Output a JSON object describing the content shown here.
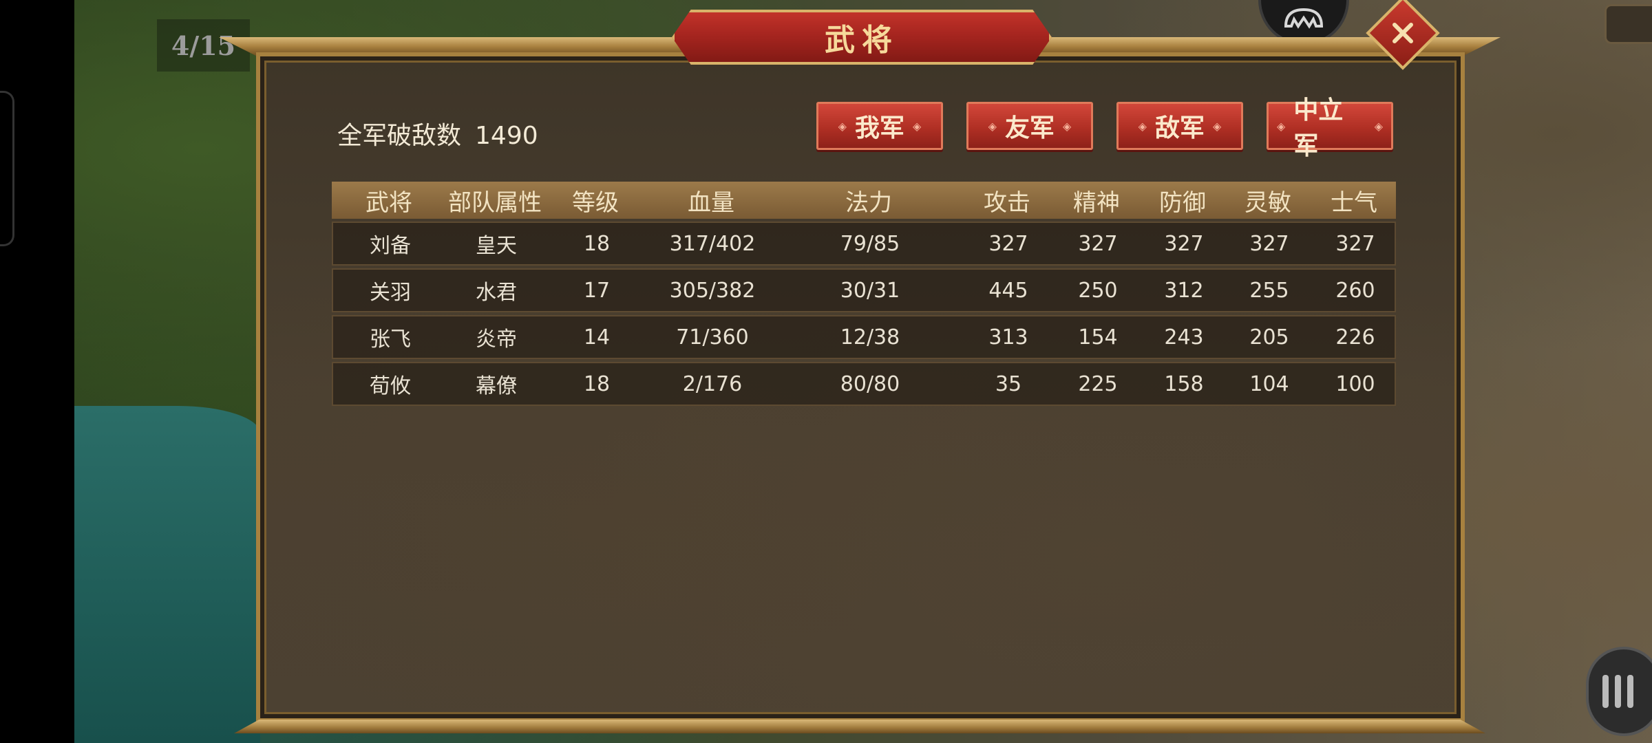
{
  "hud": {
    "page_indicator": "4/15"
  },
  "dialog": {
    "title": "武将",
    "total_kills_label": "全军破敌数",
    "total_kills_value": "1490",
    "tabs": [
      "我军",
      "友军",
      "敌军",
      "中立军"
    ],
    "columns": [
      "武将",
      "部队属性",
      "等级",
      "血量",
      "法力",
      "攻击",
      "精神",
      "防御",
      "灵敏",
      "士气"
    ],
    "rows": [
      [
        "刘备",
        "皇天",
        "18",
        "317/402",
        "79/85",
        "327",
        "327",
        "327",
        "327",
        "327"
      ],
      [
        "关羽",
        "水君",
        "17",
        "305/382",
        "30/31",
        "445",
        "250",
        "312",
        "255",
        "260"
      ],
      [
        "张飞",
        "炎帝",
        "14",
        "71/360",
        "12/38",
        "313",
        "154",
        "243",
        "205",
        "226"
      ],
      [
        "荀攸",
        "幕僚",
        "18",
        "2/176",
        "80/80",
        "35",
        "225",
        "158",
        "104",
        "100"
      ]
    ]
  },
  "icons": {
    "close": "close-icon",
    "menu": "menu-icon",
    "helmet": "helmet-icon"
  },
  "colors": {
    "accent_red": "#b02f24",
    "gold_frame": "#a7813f",
    "title_text": "#f6d99b"
  }
}
